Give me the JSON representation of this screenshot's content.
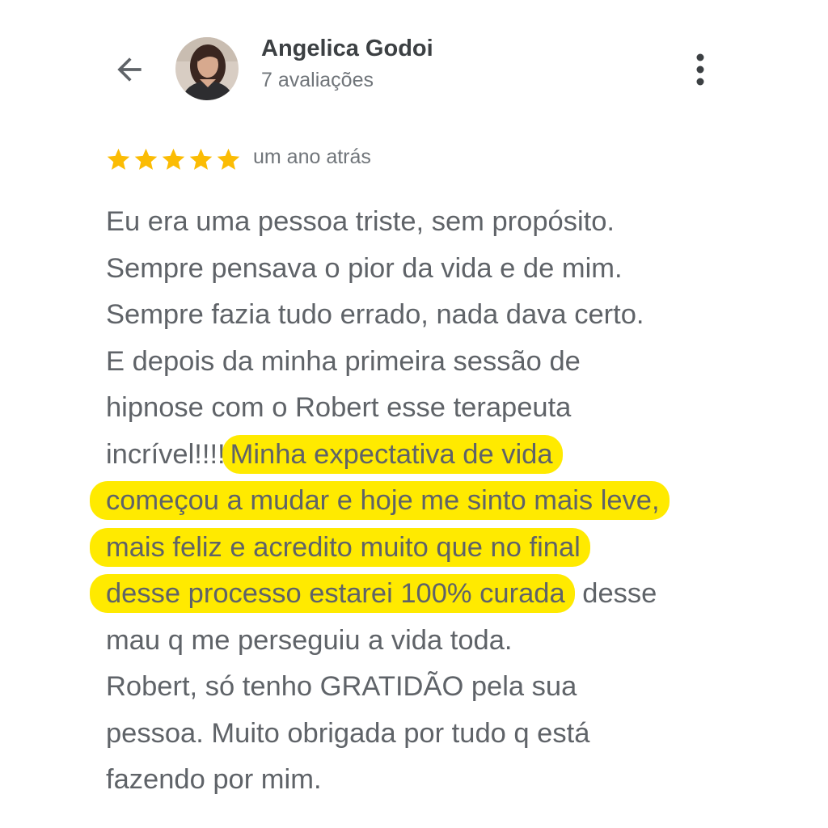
{
  "header": {
    "back_icon": "arrow-left-icon",
    "reviewer_name": "Angelica Godoi",
    "review_count": "7 avaliações",
    "more_icon": "more-vert-icon"
  },
  "review": {
    "rating": 5,
    "rating_max": 5,
    "star_color": "#fbbc04",
    "time": "um ano atrás",
    "highlight_color": "#ffea00",
    "lines": [
      "Eu era uma pessoa triste, sem propósito.",
      "Sempre pensava o pior da vida e de mim.",
      "Sempre fazia tudo errado, nada dava certo.",
      "E depois da minha primeira sessão de",
      "hipnose com o Robert esse terapeuta",
      "incrível!!!!",
      "Minha expectativa de vida",
      "começou a mudar e hoje me sinto mais leve,",
      "mais feliz e acredito muito que no final",
      "desse processo estarei 100% curada",
      " desse",
      "mau q me perseguiu a vida toda.",
      "Robert, só tenho GRATIDÃO pela sua",
      "pessoa. Muito obrigada por tudo q está",
      "fazendo por mim."
    ]
  }
}
